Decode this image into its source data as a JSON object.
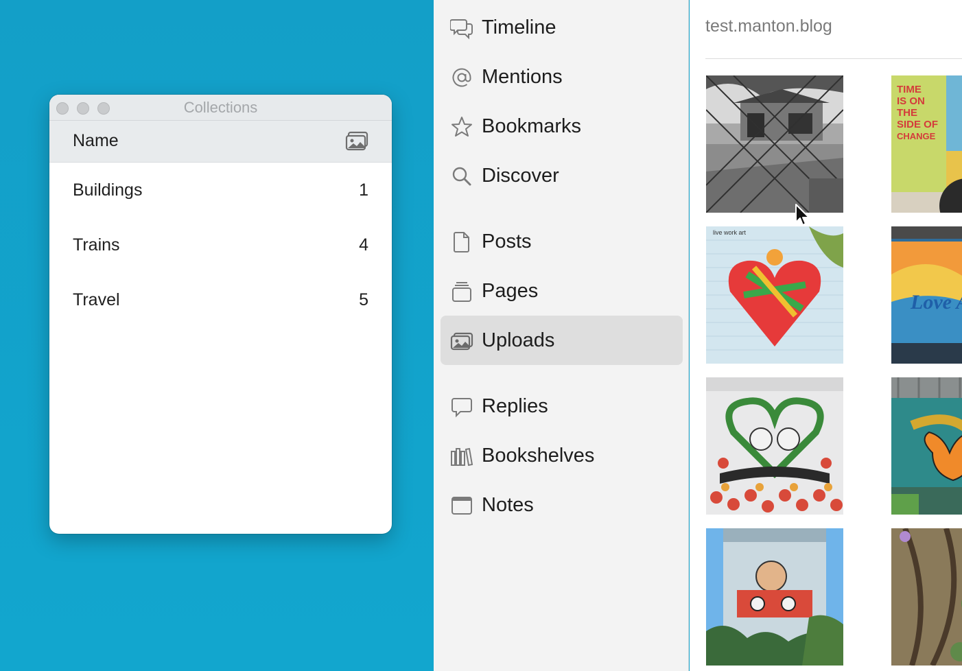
{
  "collections_window": {
    "title": "Collections",
    "column_header": {
      "name": "Name",
      "icon": "photo-icon"
    },
    "rows": [
      {
        "label": "Buildings",
        "count": "1"
      },
      {
        "label": "Trains",
        "count": "4"
      },
      {
        "label": "Travel",
        "count": "5"
      }
    ]
  },
  "sidebar": {
    "selected": "Uploads",
    "items": [
      {
        "label": "Timeline",
        "icon": "speech-bubbles-icon"
      },
      {
        "label": "Mentions",
        "icon": "at-sign-icon"
      },
      {
        "label": "Bookmarks",
        "icon": "star-icon"
      },
      {
        "label": "Discover",
        "icon": "magnifying-glass-icon"
      },
      {
        "label": "Posts",
        "icon": "document-icon"
      },
      {
        "label": "Pages",
        "icon": "pages-stack-icon"
      },
      {
        "label": "Uploads",
        "icon": "photo-icon"
      },
      {
        "label": "Replies",
        "icon": "speech-bubble-icon"
      },
      {
        "label": "Bookshelves",
        "icon": "books-icon"
      },
      {
        "label": "Notes",
        "icon": "window-icon"
      }
    ]
  },
  "content": {
    "blog_title": "test.manton.blog",
    "uploads": [
      {
        "description": "black and white abandoned building behind fence"
      },
      {
        "description": "mural: TIME IS ON THE SIDE OF CHANGE",
        "text": "TIME IS ON THE SIDE OF CHANGE"
      },
      {
        "description": "Love Fighter heart mural",
        "text": "live work art"
      },
      {
        "description": "Love Austin mural"
      },
      {
        "description": "green heart skull mural with roses"
      },
      {
        "description": "Cedar Park butterfly mural"
      },
      {
        "description": "tall building mural with faces"
      },
      {
        "description": "model train tracks"
      }
    ]
  },
  "colors": {
    "desktop": "#13a2cb",
    "sidebar_bg": "#f3f3f3",
    "selected_bg": "#dedede"
  }
}
